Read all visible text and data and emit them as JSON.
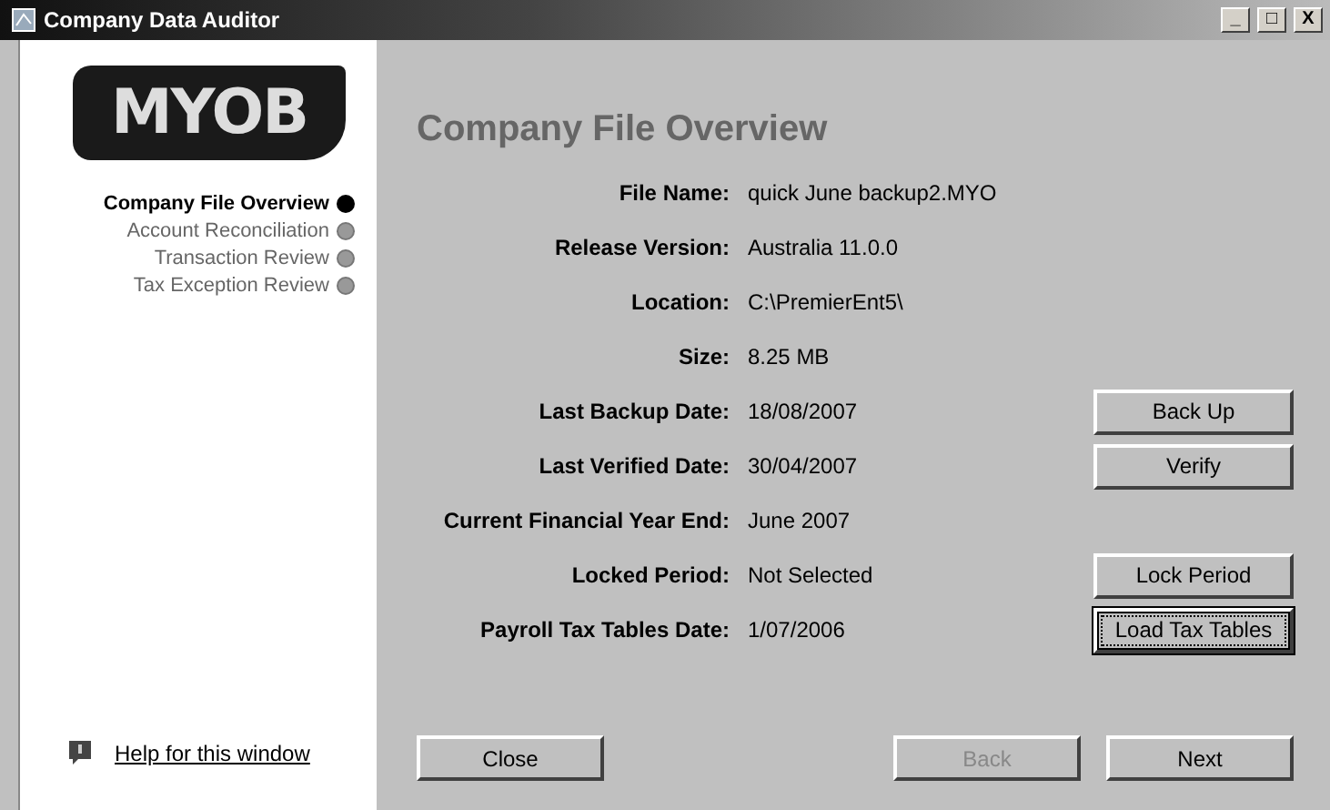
{
  "window": {
    "title": "Company Data Auditor",
    "controls": [
      "_",
      "□",
      "X"
    ]
  },
  "logo": "MYOB",
  "steps": [
    {
      "label": "Company File Overview",
      "selected": true
    },
    {
      "label": "Account Reconciliation",
      "selected": false
    },
    {
      "label": "Transaction Review",
      "selected": false
    },
    {
      "label": "Tax Exception Review",
      "selected": false
    }
  ],
  "help_link": "Help for this window",
  "heading": "Company File Overview",
  "fields": [
    {
      "label": "File Name:",
      "value": "quick June backup2.MYO"
    },
    {
      "label": "Release Version:",
      "value": "Australia 11.0.0"
    },
    {
      "label": "Location:",
      "value": "C:\\PremierEnt5\\"
    },
    {
      "label": "Size:",
      "value": "8.25 MB"
    },
    {
      "label": "Last Backup Date:",
      "value": "18/08/2007",
      "button": {
        "label": "Back Up",
        "focused": false
      }
    },
    {
      "label": "Last Verified Date:",
      "value": "30/04/2007",
      "button": {
        "label": "Verify",
        "focused": false
      }
    },
    {
      "label": "Current Financial Year End:",
      "value": "June 2007"
    },
    {
      "label": "Locked Period:",
      "value": "Not Selected",
      "button": {
        "label": "Lock Period",
        "focused": false
      }
    },
    {
      "label": "Payroll Tax Tables Date:",
      "value": "1/07/2006",
      "button": {
        "label": "Load Tax Tables",
        "focused": true
      }
    }
  ],
  "footer_buttons": [
    {
      "label": "Close",
      "disabled": false
    },
    {
      "label": "Back",
      "disabled": true
    },
    {
      "label": "Next",
      "disabled": false
    }
  ]
}
